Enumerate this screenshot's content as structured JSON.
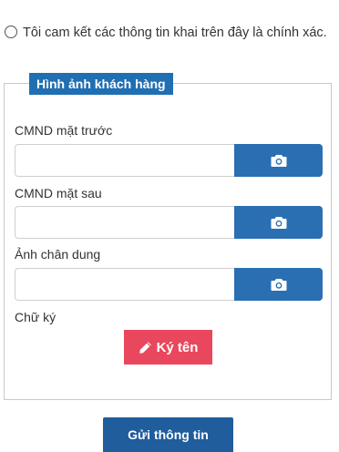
{
  "commitment": {
    "text": "Tôi cam kết các thông tin khai trên đây là chính xác."
  },
  "customer_images": {
    "legend": "Hình ảnh khách hàng",
    "fields": [
      {
        "label": "CMND mặt trước",
        "value": "",
        "icon": "camera-icon"
      },
      {
        "label": "CMND mặt sau",
        "value": "",
        "icon": "camera-icon"
      },
      {
        "label": "Ảnh chân dung",
        "value": "",
        "icon": "camera-icon"
      }
    ],
    "signature": {
      "label": "Chữ ký",
      "button_label": "Ký tên",
      "icon": "pencil-icon"
    }
  },
  "submit": {
    "label": "Gửi thông tin"
  },
  "colors": {
    "primary": "#2b6fb3",
    "legend_bg": "#1f6fb2",
    "sign_btn": "#e9475e",
    "submit_btn": "#1f5d9c"
  }
}
